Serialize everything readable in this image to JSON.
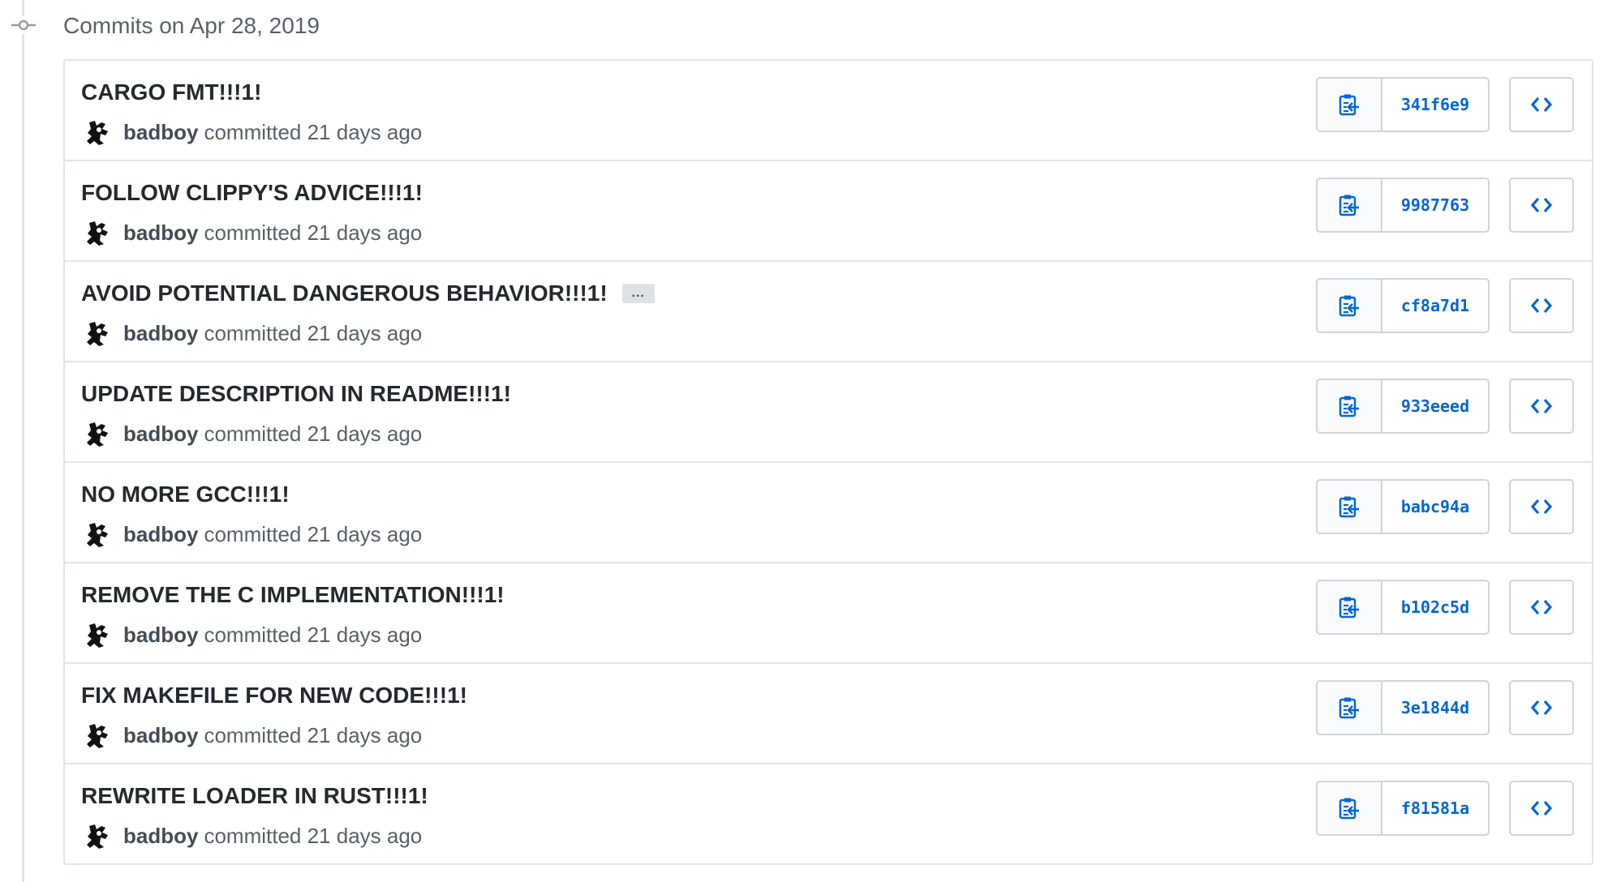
{
  "group": {
    "title": "Commits on Apr 28, 2019"
  },
  "colors": {
    "link": "#0366d6",
    "border": "#e1e4e8",
    "muted": "#586069"
  },
  "commits": [
    {
      "title": "CARGO FMT!!!1!",
      "author": "badboy",
      "action": "committed 21 days ago",
      "sha": "341f6e9",
      "has_ellipsis": false
    },
    {
      "title": "FOLLOW CLIPPY'S ADVICE!!!1!",
      "author": "badboy",
      "action": "committed 21 days ago",
      "sha": "9987763",
      "has_ellipsis": false
    },
    {
      "title": "AVOID POTENTIAL DANGEROUS BEHAVIOR!!!1!",
      "author": "badboy",
      "action": "committed 21 days ago",
      "sha": "cf8a7d1",
      "has_ellipsis": true,
      "ellipsis": "..."
    },
    {
      "title": "UPDATE DESCRIPTION IN README!!!1!",
      "author": "badboy",
      "action": "committed 21 days ago",
      "sha": "933eeed",
      "has_ellipsis": false
    },
    {
      "title": "NO MORE GCC!!!1!",
      "author": "badboy",
      "action": "committed 21 days ago",
      "sha": "babc94a",
      "has_ellipsis": false
    },
    {
      "title": "REMOVE THE C IMPLEMENTATION!!!1!",
      "author": "badboy",
      "action": "committed 21 days ago",
      "sha": "b102c5d",
      "has_ellipsis": false
    },
    {
      "title": "FIX MAKEFILE FOR NEW CODE!!!1!",
      "author": "badboy",
      "action": "committed 21 days ago",
      "sha": "3e1844d",
      "has_ellipsis": false
    },
    {
      "title": "REWRITE LOADER IN RUST!!!1!",
      "author": "badboy",
      "action": "committed 21 days ago",
      "sha": "f81581a",
      "has_ellipsis": false
    }
  ]
}
